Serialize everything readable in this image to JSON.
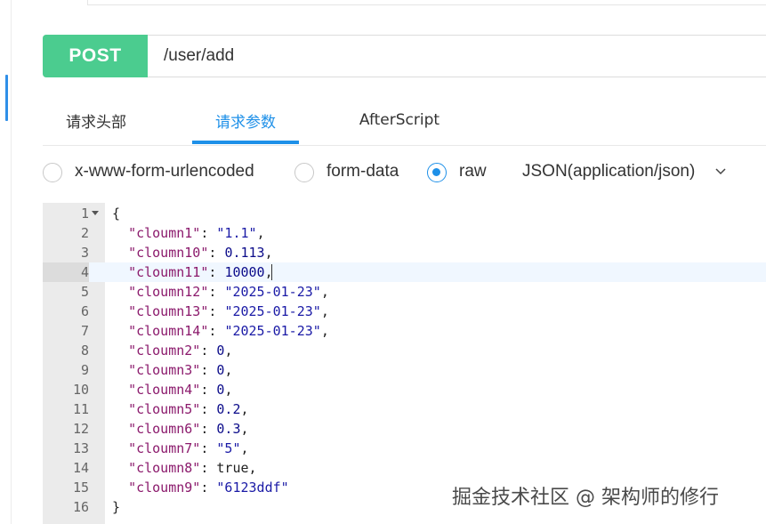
{
  "request": {
    "method": "POST",
    "url": "/user/add"
  },
  "tabs": [
    {
      "label": "请求头部",
      "active": false
    },
    {
      "label": "请求参数",
      "active": true
    },
    {
      "label": "AfterScript",
      "active": false
    }
  ],
  "body_types": [
    {
      "label": "x-www-form-urlencoded",
      "checked": false
    },
    {
      "label": "form-data",
      "checked": false
    },
    {
      "label": "raw",
      "checked": true
    }
  ],
  "content_type": "JSON(application/json)",
  "editor": {
    "active_line": 4,
    "lines": [
      {
        "n": "1",
        "parts": [
          [
            "p",
            "{"
          ]
        ]
      },
      {
        "n": "2",
        "parts": [
          [
            "p",
            "  "
          ],
          [
            "k",
            "\"cloumn1\""
          ],
          [
            "p",
            ": "
          ],
          [
            "s",
            "\"1.1\""
          ],
          [
            "p",
            ","
          ]
        ]
      },
      {
        "n": "3",
        "parts": [
          [
            "p",
            "  "
          ],
          [
            "k",
            "\"cloumn10\""
          ],
          [
            "p",
            ": "
          ],
          [
            "n",
            "0.113"
          ],
          [
            "p",
            ","
          ]
        ]
      },
      {
        "n": "4",
        "parts": [
          [
            "p",
            "  "
          ],
          [
            "k",
            "\"cloumn11\""
          ],
          [
            "p",
            ": "
          ],
          [
            "n",
            "10000"
          ],
          [
            "p",
            ","
          ]
        ]
      },
      {
        "n": "5",
        "parts": [
          [
            "p",
            "  "
          ],
          [
            "k",
            "\"cloumn12\""
          ],
          [
            "p",
            ": "
          ],
          [
            "s",
            "\"2025-01-23\""
          ],
          [
            "p",
            ","
          ]
        ]
      },
      {
        "n": "6",
        "parts": [
          [
            "p",
            "  "
          ],
          [
            "k",
            "\"cloumn13\""
          ],
          [
            "p",
            ": "
          ],
          [
            "s",
            "\"2025-01-23\""
          ],
          [
            "p",
            ","
          ]
        ]
      },
      {
        "n": "7",
        "parts": [
          [
            "p",
            "  "
          ],
          [
            "k",
            "\"cloumn14\""
          ],
          [
            "p",
            ": "
          ],
          [
            "s",
            "\"2025-01-23\""
          ],
          [
            "p",
            ","
          ]
        ]
      },
      {
        "n": "8",
        "parts": [
          [
            "p",
            "  "
          ],
          [
            "k",
            "\"cloumn2\""
          ],
          [
            "p",
            ": "
          ],
          [
            "n",
            "0"
          ],
          [
            "p",
            ","
          ]
        ]
      },
      {
        "n": "9",
        "parts": [
          [
            "p",
            "  "
          ],
          [
            "k",
            "\"cloumn3\""
          ],
          [
            "p",
            ": "
          ],
          [
            "n",
            "0"
          ],
          [
            "p",
            ","
          ]
        ]
      },
      {
        "n": "10",
        "parts": [
          [
            "p",
            "  "
          ],
          [
            "k",
            "\"cloumn4\""
          ],
          [
            "p",
            ": "
          ],
          [
            "n",
            "0"
          ],
          [
            "p",
            ","
          ]
        ]
      },
      {
        "n": "11",
        "parts": [
          [
            "p",
            "  "
          ],
          [
            "k",
            "\"cloumn5\""
          ],
          [
            "p",
            ": "
          ],
          [
            "n",
            "0.2"
          ],
          [
            "p",
            ","
          ]
        ]
      },
      {
        "n": "12",
        "parts": [
          [
            "p",
            "  "
          ],
          [
            "k",
            "\"cloumn6\""
          ],
          [
            "p",
            ": "
          ],
          [
            "n",
            "0.3"
          ],
          [
            "p",
            ","
          ]
        ]
      },
      {
        "n": "13",
        "parts": [
          [
            "p",
            "  "
          ],
          [
            "k",
            "\"cloumn7\""
          ],
          [
            "p",
            ": "
          ],
          [
            "s",
            "\"5\""
          ],
          [
            "p",
            ","
          ]
        ]
      },
      {
        "n": "14",
        "parts": [
          [
            "p",
            "  "
          ],
          [
            "k",
            "\"cloumn8\""
          ],
          [
            "p",
            ": "
          ],
          [
            "b",
            "true"
          ],
          [
            "p",
            ","
          ]
        ]
      },
      {
        "n": "15",
        "parts": [
          [
            "p",
            "  "
          ],
          [
            "k",
            "\"cloumn9\""
          ],
          [
            "p",
            ": "
          ],
          [
            "s",
            "\"6123ddf\""
          ]
        ]
      },
      {
        "n": "16",
        "parts": [
          [
            "p",
            "}"
          ]
        ]
      }
    ]
  },
  "watermark": "掘金技术社区 @ 架构师的修行",
  "colors": {
    "method_bg": "#4bcc8f",
    "accent": "#1e90e8",
    "json_key": "#8b1a6c",
    "json_string": "#1a1aa6",
    "json_number": "#0b0b8a"
  },
  "icons": {
    "fold": "triangle-down",
    "content_type_dropdown": "chevron-down-icon"
  }
}
